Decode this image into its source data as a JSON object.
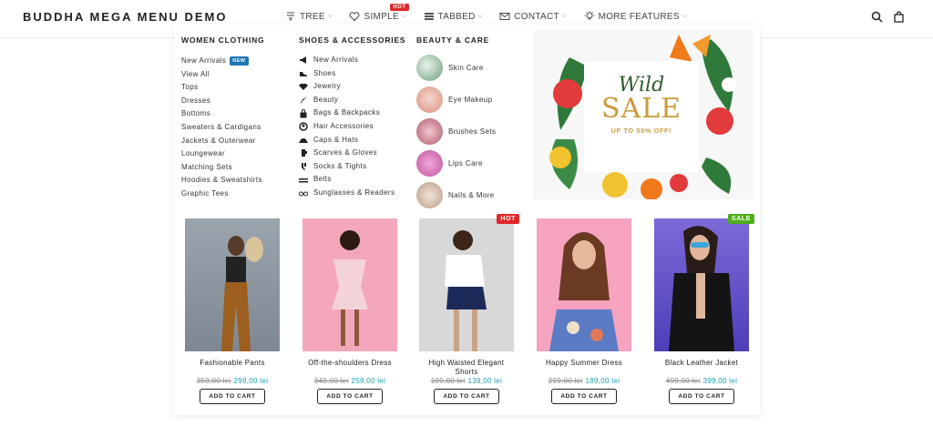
{
  "brand": "BUDDHA MEGA MENU DEMO",
  "nav": [
    {
      "label": "TREE",
      "icon": "tree-icon"
    },
    {
      "label": "SIMPLE",
      "icon": "heart-icon",
      "badge": "HOT"
    },
    {
      "label": "TABBED",
      "icon": "tabs-icon"
    },
    {
      "label": "CONTACT",
      "icon": "mail-icon"
    },
    {
      "label": "MORE FEATURES",
      "icon": "bulb-icon"
    }
  ],
  "women": {
    "title": "WOMEN CLOTHING",
    "items": [
      "New Arrivals",
      "View All",
      "Tops",
      "Dresses",
      "Bottoms",
      "Sweaters & Cardigans",
      "Jackets & Outerwear",
      "Loungewear",
      "Matching Sets",
      "Hoodies & Sweatshirts",
      "Graphic Tees"
    ],
    "new_badge": "NEW"
  },
  "shoes": {
    "title": "SHOES & ACCESSORIES",
    "items": [
      "New Arrivals",
      "Shoes",
      "Jewelry",
      "Beauty",
      "Bags & Backpacks",
      "Hair Accessories",
      "Caps & Hats",
      "Scarves & Gloves",
      "Socks & Tights",
      "Belts",
      "Sunglasses & Readers"
    ]
  },
  "beauty": {
    "title": "BEAUTY & CARE",
    "items": [
      "Skin Care",
      "Eye Makeup",
      "Brushes Sets",
      "Lips Care",
      "Nails & More"
    ]
  },
  "banner": {
    "wild": "Wild",
    "sale": "SALE",
    "upto": "UP TO 50% OFF!"
  },
  "products": [
    {
      "name": "Fashionable Pants",
      "old": "359,00 lei",
      "new": "299,00 lei",
      "btn": "ADD TO CART",
      "badge": ""
    },
    {
      "name": "Off-the-shoulders Dress",
      "old": "349,00 lei",
      "new": "259,00 lei",
      "btn": "ADD TO CART",
      "badge": ""
    },
    {
      "name": "High Waisted Elegant Shorts",
      "old": "199,00 lei",
      "new": "139,00 lei",
      "btn": "ADD TO CART",
      "badge": "HOT"
    },
    {
      "name": "Happy Summer Dress",
      "old": "299,00 lei",
      "new": "189,00 lei",
      "btn": "ADD TO CART",
      "badge": ""
    },
    {
      "name": "Black Leather Jacket",
      "old": "499,00 lei",
      "new": "399,00 lei",
      "btn": "ADD TO CART",
      "badge": "SALE"
    }
  ],
  "colors": {
    "hot": "#e02828",
    "sale": "#4caf1a",
    "new": "#1f77b4",
    "price": "#1aa0b0"
  }
}
